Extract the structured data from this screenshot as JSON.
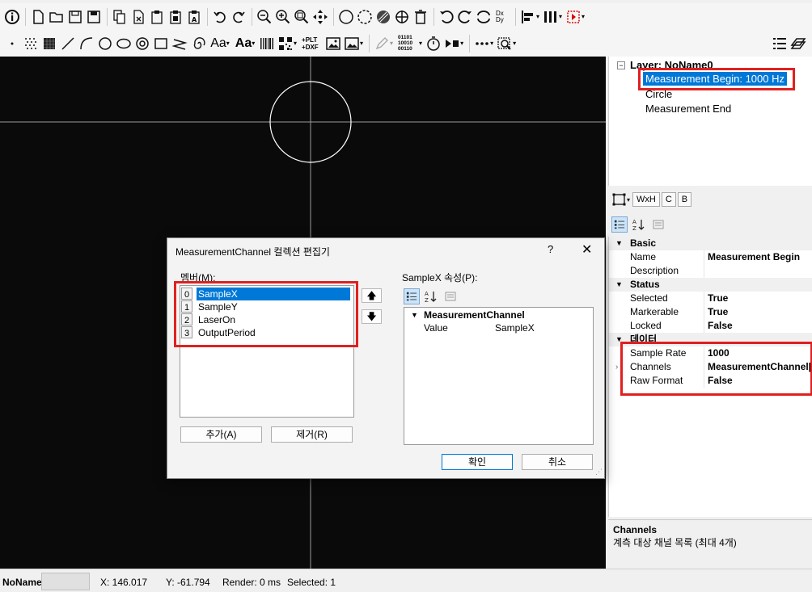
{
  "toolbar1": {
    "icons": [
      "info-icon",
      "new-document-icon",
      "open-folder-icon",
      "save-icon",
      "save-as-icon",
      "copy-icon",
      "cut-icon",
      "paste-icon",
      "paste-special-icon",
      "paste-text-icon",
      "undo-icon",
      "redo-icon",
      "zoom-out-icon",
      "zoom-in-icon",
      "zoom-fit-icon",
      "pan-icon",
      "circle-select-icon",
      "lasso-icon",
      "hatch-icon",
      "explode-icon",
      "delete-icon",
      "rotate-ccw-icon",
      "rotate-cw-icon",
      "mirror-icon",
      "dxdy-icon",
      "align-icon",
      "distribute-icon",
      "run-icon"
    ],
    "dxdy_label": "Dx Dy"
  },
  "toolbar2": {
    "text_tool": "Aa",
    "text_tool_bold": "Aa",
    "plt_label": "+PLT +DXF",
    "binary_label": "01101 10010 00110"
  },
  "tree": {
    "layer": "Layer: NoName0",
    "items": [
      "Measurement Begin: 1000 Hz",
      "Circle",
      "Measurement End"
    ],
    "selected_index": 0
  },
  "prop_tabs": [
    "WxH",
    "C",
    "B"
  ],
  "grid": {
    "categories": [
      {
        "name": "Basic",
        "rows": [
          {
            "name": "Name",
            "value": "Measurement Begin"
          },
          {
            "name": "Description",
            "value": ""
          }
        ]
      },
      {
        "name": "Status",
        "rows": [
          {
            "name": "Selected",
            "value": "True"
          },
          {
            "name": "Markerable",
            "value": "True"
          },
          {
            "name": "Locked",
            "value": "False"
          }
        ]
      },
      {
        "name": "데이터",
        "rows": [
          {
            "name": "Sample Rate",
            "value": "1000"
          },
          {
            "name": "Channels",
            "value": "MeasurementChannel[]"
          },
          {
            "name": "Raw Format",
            "value": "False"
          }
        ]
      }
    ]
  },
  "description": {
    "title": "Channels",
    "text": "계측 대상 채널 목록 (최대 4개)"
  },
  "status": {
    "doc": "NoName",
    "x": "X: 146.017",
    "y": "Y: -61.794",
    "render": "Render: 0 ms",
    "selected": "Selected: 1"
  },
  "dialog": {
    "title": "MeasurementChannel 컬렉션 편집기",
    "help": "?",
    "close": "✕",
    "members_label": "멤버(M):",
    "members": [
      {
        "index": "0",
        "name": "SampleX"
      },
      {
        "index": "1",
        "name": "SampleY"
      },
      {
        "index": "2",
        "name": "LaserOn"
      },
      {
        "index": "3",
        "name": "OutputPeriod"
      }
    ],
    "selected_member": 0,
    "up_arrow": "🡅",
    "down_arrow": "🡇",
    "add_button": "추가(A)",
    "remove_button": "제거(R)",
    "props_label": "SampleX 속성(P):",
    "grid_category": "MeasurementChannel",
    "grid_rows": [
      {
        "name": "Value",
        "value": "SampleX"
      }
    ],
    "ok_button": "확인",
    "cancel_button": "취소"
  },
  "colors": {
    "selection": "#0078d7",
    "highlight_box": "#e02020",
    "canvas": "#0a0a0a"
  }
}
